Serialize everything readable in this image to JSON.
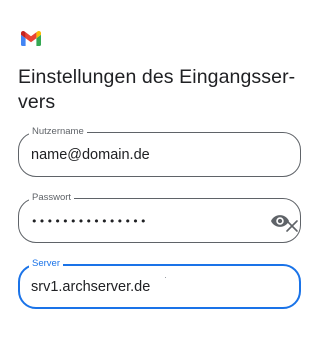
{
  "header": {
    "logo_icon": "gmail-logo-icon",
    "title": "Einstellungen des Eingangsser­vers",
    "title_display": "Einstellungen des Eingangsser-\nvers"
  },
  "form": {
    "username": {
      "label": "Nutzername",
      "value": "name@domain.de"
    },
    "password": {
      "label": "Passwort",
      "value": "•••••••••••••••",
      "toggle_icon": "eye-icon"
    },
    "clear_icon": "close-icon",
    "server": {
      "label": "Server",
      "value": "srv1.archserver.de"
    }
  },
  "colors": {
    "accent": "#1a73e8",
    "outline": "#5f6368",
    "text": "#202124",
    "gmail_red": "#ea4335",
    "gmail_blue": "#4285f4",
    "gmail_green": "#34a853",
    "gmail_yellow": "#fbbc04",
    "gmail_darkred": "#c5221f"
  }
}
